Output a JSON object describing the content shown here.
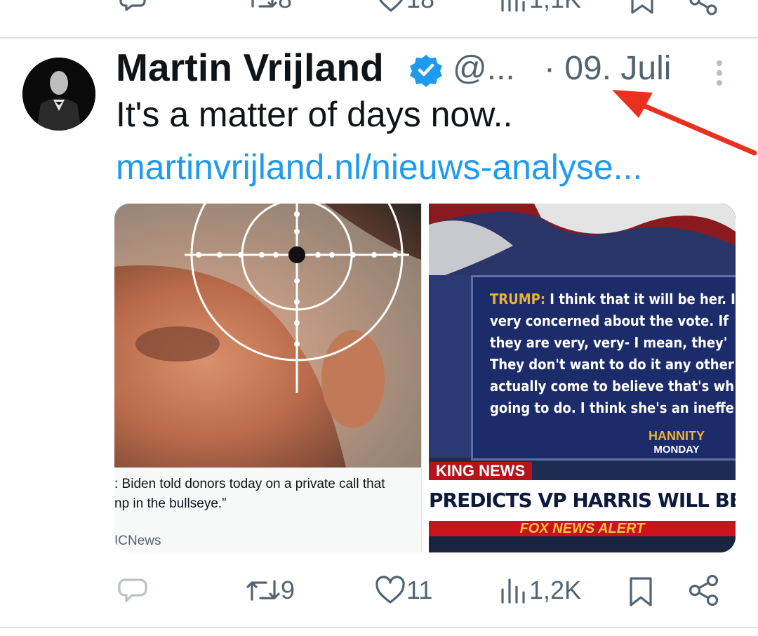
{
  "prev_tweet": {
    "retweets": "8",
    "likes": "18",
    "views": "1,1K"
  },
  "tweet": {
    "author_name": "Martin Vrijland",
    "handle": "@...",
    "date": "· 09. Juli",
    "text": "It's a matter of days now..",
    "link": "martinvrijland.nl/nieuws-analyse...",
    "media": {
      "left_card": {
        "caption_line1": ": Biden told donors today on a private call that",
        "caption_line2": "np in the bullseye.”",
        "source": "ICNews"
      },
      "right_card": {
        "quote_speaker": "TRUMP:",
        "quote_line1": " I think that it will be her. I",
        "quote_line2": "very concerned about the vote. If",
        "quote_line3": "they are very, very- I mean, they'",
        "quote_line4": "They don't want to do it any other",
        "quote_line5": "actually come to believe that's wh",
        "quote_line6": "going to do. I think she's an ineffe",
        "show_name": "HANNITY",
        "show_day": "MONDAY",
        "breaking": "KING NEWS",
        "headline": "PREDICTS VP HARRIS WILL BE THE NOMINE",
        "alert": "FOX NEWS ALERT"
      }
    },
    "actions": {
      "retweets": "9",
      "likes": "11",
      "views": "1,2K"
    }
  },
  "colors": {
    "accent": "#1d9bf0",
    "secondary_text": "#536471",
    "annotation_arrow": "#e8321f"
  }
}
